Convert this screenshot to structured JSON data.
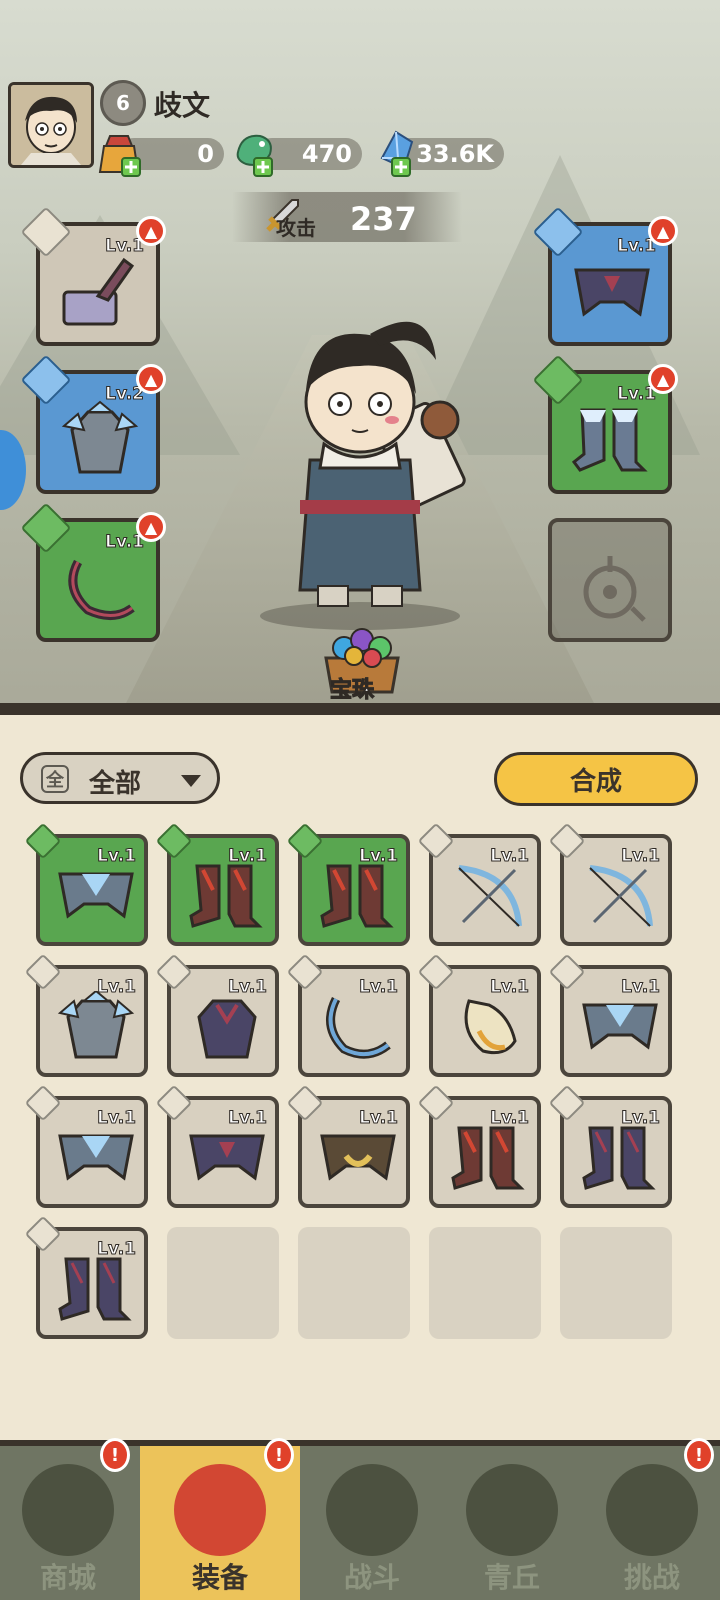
{
  "player": {
    "name": "歧文",
    "level": "6"
  },
  "resources": [
    {
      "id": "coupon",
      "value": "0",
      "icon": "lucky-bag-icon"
    },
    {
      "id": "jade",
      "value": "470",
      "icon": "jade-dragon-icon"
    },
    {
      "id": "crystal",
      "value": "33.6K",
      "icon": "blue-crystal-icon"
    }
  ],
  "attack": {
    "label": "攻击",
    "value": "237"
  },
  "treasure": {
    "label": "宝珠"
  },
  "equipped": {
    "weapon": {
      "lv": "Lv.1",
      "rarity": "grey"
    },
    "armor": {
      "lv": "Lv.2",
      "rarity": "blue"
    },
    "ring": {
      "lv": "Lv.1",
      "rarity": "green"
    },
    "belt": {
      "lv": "Lv.1",
      "rarity": "blue"
    },
    "boots": {
      "lv": "Lv.1",
      "rarity": "green"
    }
  },
  "filter": {
    "icon_char": "全",
    "label": "全部"
  },
  "synth_label": "合成",
  "inventory": [
    {
      "lv": "Lv.1",
      "rarity": "green",
      "icon": "frost-belt-icon"
    },
    {
      "lv": "Lv.1",
      "rarity": "green",
      "icon": "flame-boots-icon"
    },
    {
      "lv": "Lv.1",
      "rarity": "green",
      "icon": "flame-boots-icon"
    },
    {
      "lv": "Lv.1",
      "rarity": "grey",
      "icon": "ice-bow-icon"
    },
    {
      "lv": "Lv.1",
      "rarity": "grey",
      "icon": "ice-bow-icon"
    },
    {
      "lv": "Lv.1",
      "rarity": "grey",
      "icon": "frost-armor-icon"
    },
    {
      "lv": "Lv.1",
      "rarity": "grey",
      "icon": "dark-armor-icon"
    },
    {
      "lv": "Lv.1",
      "rarity": "grey",
      "icon": "ice-ring-icon"
    },
    {
      "lv": "Lv.1",
      "rarity": "grey",
      "icon": "gold-ring-icon"
    },
    {
      "lv": "Lv.1",
      "rarity": "grey",
      "icon": "frost-belt-icon"
    },
    {
      "lv": "Lv.1",
      "rarity": "grey",
      "icon": "frost-belt-icon"
    },
    {
      "lv": "Lv.1",
      "rarity": "grey",
      "icon": "dark-belt-icon"
    },
    {
      "lv": "Lv.1",
      "rarity": "grey",
      "icon": "gold-belt-icon"
    },
    {
      "lv": "Lv.1",
      "rarity": "grey",
      "icon": "flame-boots-icon"
    },
    {
      "lv": "Lv.1",
      "rarity": "grey",
      "icon": "dark-boots-icon"
    },
    {
      "lv": "Lv.1",
      "rarity": "grey",
      "icon": "dark-boots-icon"
    }
  ],
  "nav": [
    {
      "label": "商城",
      "active": false,
      "alert": "!"
    },
    {
      "label": "装备",
      "active": true,
      "alert": "!"
    },
    {
      "label": "战斗",
      "active": false,
      "alert": ""
    },
    {
      "label": "青丘",
      "active": false,
      "alert": ""
    },
    {
      "label": "挑战",
      "active": false,
      "alert": "!"
    }
  ]
}
